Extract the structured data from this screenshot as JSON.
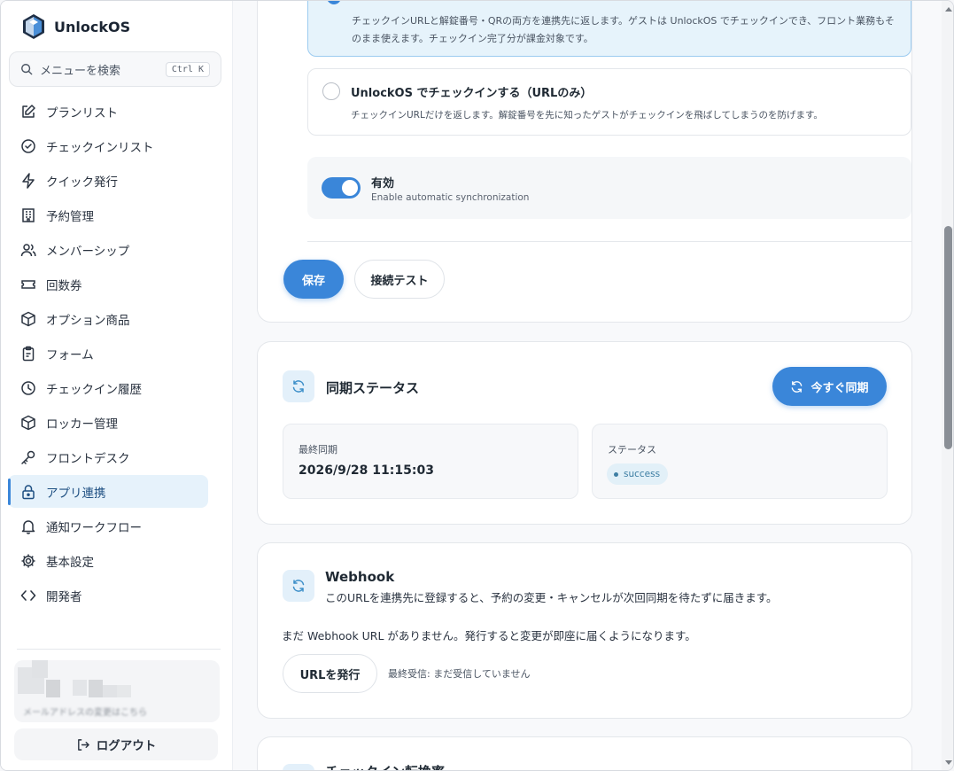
{
  "app": {
    "name": "UnlockOS"
  },
  "search": {
    "placeholder": "メニューを検索",
    "shortcut": "Ctrl K"
  },
  "nav": [
    {
      "label": "プランリスト",
      "icon": "edit-icon",
      "active": false
    },
    {
      "label": "チェックインリスト",
      "icon": "check-circle-icon",
      "active": false
    },
    {
      "label": "クイック発行",
      "icon": "bolt-icon",
      "active": false
    },
    {
      "label": "予約管理",
      "icon": "building-icon",
      "active": false
    },
    {
      "label": "メンバーシップ",
      "icon": "users-icon",
      "active": false
    },
    {
      "label": "回数券",
      "icon": "ticket-icon",
      "active": false
    },
    {
      "label": "オプション商品",
      "icon": "box-icon",
      "active": false
    },
    {
      "label": "フォーム",
      "icon": "clipboard-icon",
      "active": false
    },
    {
      "label": "チェックイン履歴",
      "icon": "history-icon",
      "active": false
    },
    {
      "label": "ロッカー管理",
      "icon": "locker-icon",
      "active": false
    },
    {
      "label": "フロントデスク",
      "icon": "key-icon",
      "active": false
    },
    {
      "label": "アプリ連携",
      "icon": "lock-icon",
      "active": true
    },
    {
      "label": "通知ワークフロー",
      "icon": "bell-icon",
      "active": false
    },
    {
      "label": "基本設定",
      "icon": "gear-icon",
      "active": false
    },
    {
      "label": "開発者",
      "icon": "code-icon",
      "active": false
    }
  ],
  "account": {
    "subtitle": "メールアドレスの変更はこちら"
  },
  "logout": {
    "label": "ログアウト"
  },
  "integration": {
    "selected_option_desc": "チェックインURLと解錠番号・QRの両方を連携先に返します。ゲストは UnlockOS でチェックインでき、フロント業務もそのまま使えます。チェックイン完了分が課金対象です。",
    "option_url_only": {
      "title": "UnlockOS でチェックインする（URLのみ）",
      "desc": "チェックインURLだけを返します。解錠番号を先に知ったゲストがチェックインを飛ばしてしまうのを防げます。"
    },
    "toggle": {
      "title": "有効",
      "subtitle": "Enable automatic synchronization",
      "on": true
    },
    "save_label": "保存",
    "test_label": "接続テスト"
  },
  "sync": {
    "title": "同期ステータス",
    "sync_now_label": "今すぐ同期",
    "last_sync_label": "最終同期",
    "last_sync_value": "2026/9/28 11:15:03",
    "status_label": "ステータス",
    "status_value": "success"
  },
  "webhook": {
    "title": "Webhook",
    "subtitle": "このURLを連携先に登録すると、予約の変更・キャンセルが次回同期を待たずに届きます。",
    "note": "まだ Webhook URL がありません。発行すると変更が即座に届くようになります。",
    "issue_label": "URLを発行",
    "last_received": "最終受信: まだ受信していません"
  },
  "next_card": {
    "title": "チェックイン転換率"
  },
  "colors": {
    "accent": "#3a86d9",
    "active_nav_bg": "#e6f2fb",
    "badge_bg": "#e2f0f8"
  }
}
